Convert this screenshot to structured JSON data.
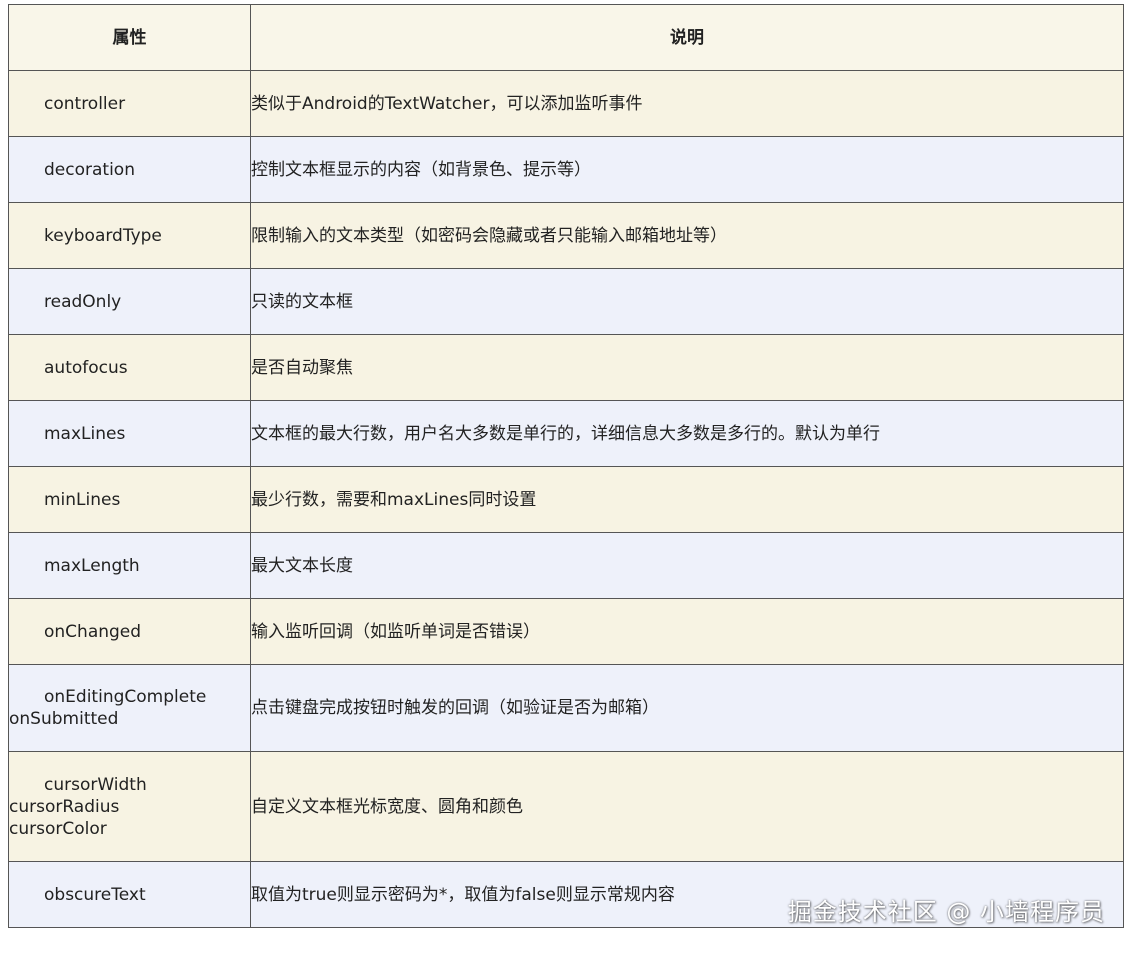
{
  "table": {
    "headers": {
      "property": "属性",
      "description": "说明"
    },
    "rows": [
      {
        "property": [
          "controller"
        ],
        "description": "类似于Android的TextWatcher，可以添加监听事件"
      },
      {
        "property": [
          "decoration"
        ],
        "description": "控制文本框显示的内容（如背景色、提示等）"
      },
      {
        "property": [
          "keyboardType"
        ],
        "description": "限制输入的文本类型（如密码会隐藏或者只能输入邮箱地址等）"
      },
      {
        "property": [
          "readOnly"
        ],
        "description": "只读的文本框"
      },
      {
        "property": [
          "autofocus"
        ],
        "description": "是否自动聚焦"
      },
      {
        "property": [
          "maxLines"
        ],
        "description": "文本框的最大行数，用户名大多数是单行的，详细信息大多数是多行的。默认为单行"
      },
      {
        "property": [
          "minLines"
        ],
        "description": "最少行数，需要和maxLines同时设置"
      },
      {
        "property": [
          "maxLength"
        ],
        "description": "最大文本长度"
      },
      {
        "property": [
          "onChanged"
        ],
        "description": "输入监听回调（如监听单词是否错误）"
      },
      {
        "property": [
          "onEditingComplete",
          "onSubmitted"
        ],
        "description": "点击键盘完成按钮时触发的回调（如验证是否为邮箱）"
      },
      {
        "property": [
          "cursorWidth",
          "cursorRadius",
          "cursorColor"
        ],
        "description": "自定义文本框光标宽度、圆角和颜色"
      },
      {
        "property": [
          "obscureText"
        ],
        "description": "取值为true则显示密码为*，取值为false则显示常规内容"
      }
    ]
  },
  "watermark": "掘金技术社区 @ 小墙程序员",
  "colors": {
    "border": "#555555",
    "row_odd": "#f7f3e3",
    "row_even": "#eef1fa",
    "text": "#222222"
  }
}
